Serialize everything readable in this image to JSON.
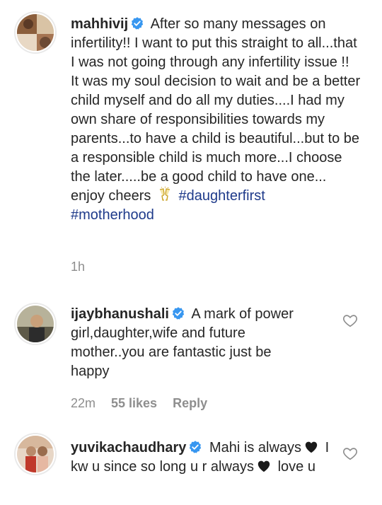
{
  "comments": [
    {
      "username": "mahhivij",
      "text": "After so many messages on infertility!! I want to put this straight to all...that I was not going through any infertility issue !! It was my soul decision to wait and be a better child myself and do all my duties....I had my own share of responsibilities towards my parents...to have a child is beautiful...but to be a responsible child is much more...I choose the later.....be a good child to have one... enjoy cheers",
      "hashtags": [
        "#daughterfirst",
        "#motherhood"
      ],
      "time": "1h"
    },
    {
      "username": "ijaybhanushali",
      "text": "A mark of power girl,daughter,wife and future mother..you are fantastic just be happy",
      "time": "22m",
      "likes": "55 likes",
      "reply": "Reply"
    },
    {
      "username": "yuvikachaudhary",
      "text_part1": "Mahi is always",
      "text_part2": "I kw u since so long u r always",
      "text_part3": "love u"
    }
  ],
  "icons": {
    "verified": "verified-badge-icon",
    "heart": "heart-outline-icon",
    "cheers": "champagne-glasses-emoji",
    "red_heart": "red-heart-emoji"
  },
  "colors": {
    "text": "#262626",
    "meta": "#8e8e8e",
    "hashtag": "#1e3a8a",
    "verified": "#3897f0",
    "heart_emoji": "#1a1a1a"
  }
}
